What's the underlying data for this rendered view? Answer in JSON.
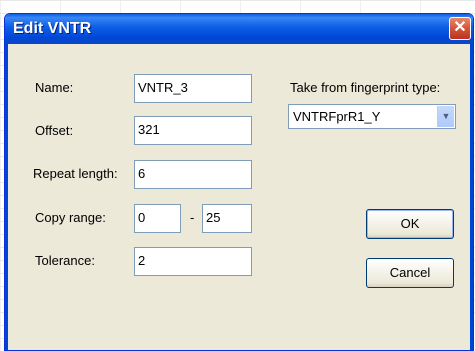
{
  "window": {
    "title": "Edit VNTR",
    "close_glyph": "✕"
  },
  "form": {
    "name_label": "Name:",
    "name_value": "VNTR_3",
    "offset_label": "Offset:",
    "offset_value": "321",
    "repeat_label": "Repeat length:",
    "repeat_value": "6",
    "copy_label": "Copy range:",
    "copy_from": "0",
    "copy_separator": "-",
    "copy_to": "25",
    "tolerance_label": "Tolerance:",
    "tolerance_value": "2"
  },
  "fingerprint": {
    "label": "Take from fingerprint type:",
    "selected": "VNTRFprR1_Y"
  },
  "buttons": {
    "ok": "OK",
    "cancel": "Cancel"
  },
  "colors": {
    "titlebar": "#0058e6",
    "dialog_bg": "#ece9d8",
    "field_border": "#7f9db9"
  }
}
